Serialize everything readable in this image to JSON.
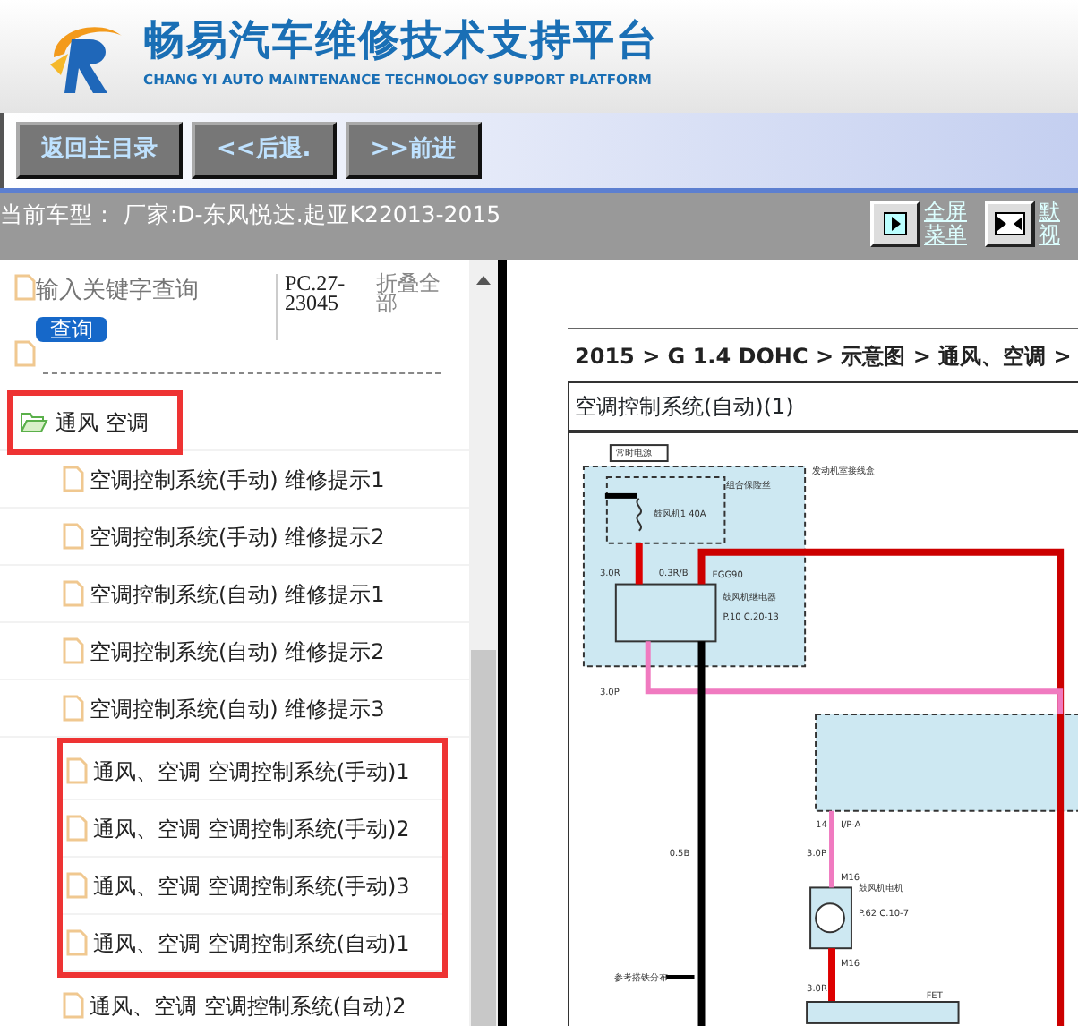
{
  "header": {
    "title": "畅易汽车维修技术支持平台",
    "subtitle": "CHANG YI AUTO MAINTENANCE TECHNOLOGY SUPPORT PLATFORM"
  },
  "nav_buttons": [
    "返回主目录",
    "<<后退.",
    ">>前进"
  ],
  "vehicle_bar": {
    "text": "当前车型： 厂家:D-东风悦达.起亚K22013-2015",
    "view_buttons": [
      {
        "kind": "fullscreen",
        "lines": [
          "全屏",
          "菜单"
        ]
      },
      {
        "kind": "default",
        "lines": [
          "默",
          "视"
        ]
      }
    ]
  },
  "sidebar": {
    "search": {
      "placeholder": "输入关键字查询",
      "button": "查询",
      "code": "PC.27-23045",
      "collapse": "折叠全部"
    },
    "tree": [
      {
        "label": "通风 空调",
        "expanded": true,
        "highlighted": true,
        "children": [
          {
            "label": "空调控制系统(手动) 维修提示1",
            "highlighted": false
          },
          {
            "label": "空调控制系统(手动) 维修提示2",
            "highlighted": false
          },
          {
            "label": "空调控制系统(自动) 维修提示1",
            "highlighted": false
          },
          {
            "label": "空调控制系统(自动) 维修提示2",
            "highlighted": false
          },
          {
            "label": "空调控制系统(自动) 维修提示3",
            "highlighted": false
          },
          {
            "label": "通风、空调 空调控制系统(手动)1",
            "highlighted": true
          },
          {
            "label": "通风、空调 空调控制系统(手动)2",
            "highlighted": true
          },
          {
            "label": "通风、空调 空调控制系统(手动)3",
            "highlighted": true
          },
          {
            "label": "通风、空调 空调控制系统(自动)1",
            "highlighted": true
          },
          {
            "label": "通风、空调 空调控制系统(自动)2",
            "highlighted": false
          }
        ]
      }
    ]
  },
  "document": {
    "breadcrumb": "2015 > G 1.4 DOHC > 示意图 > 通风、空调 >",
    "title": "空调控制系统(自动)(1)",
    "diagram_labels": [
      "常时电源",
      "组合保险丝",
      "发动机室接线盒",
      "鼓风机1 40A",
      "3.0R",
      "0.3R/B",
      "EGG90",
      "鼓风机继电器",
      "P.10 C.20-13",
      "3.0P",
      "0.5B",
      "14",
      "I/P-A",
      "3.0P",
      "M16",
      "鼓风机电机",
      "P.62 C.10-7",
      "M16",
      "3.0R",
      "参考搭铁分布",
      "FET"
    ]
  }
}
